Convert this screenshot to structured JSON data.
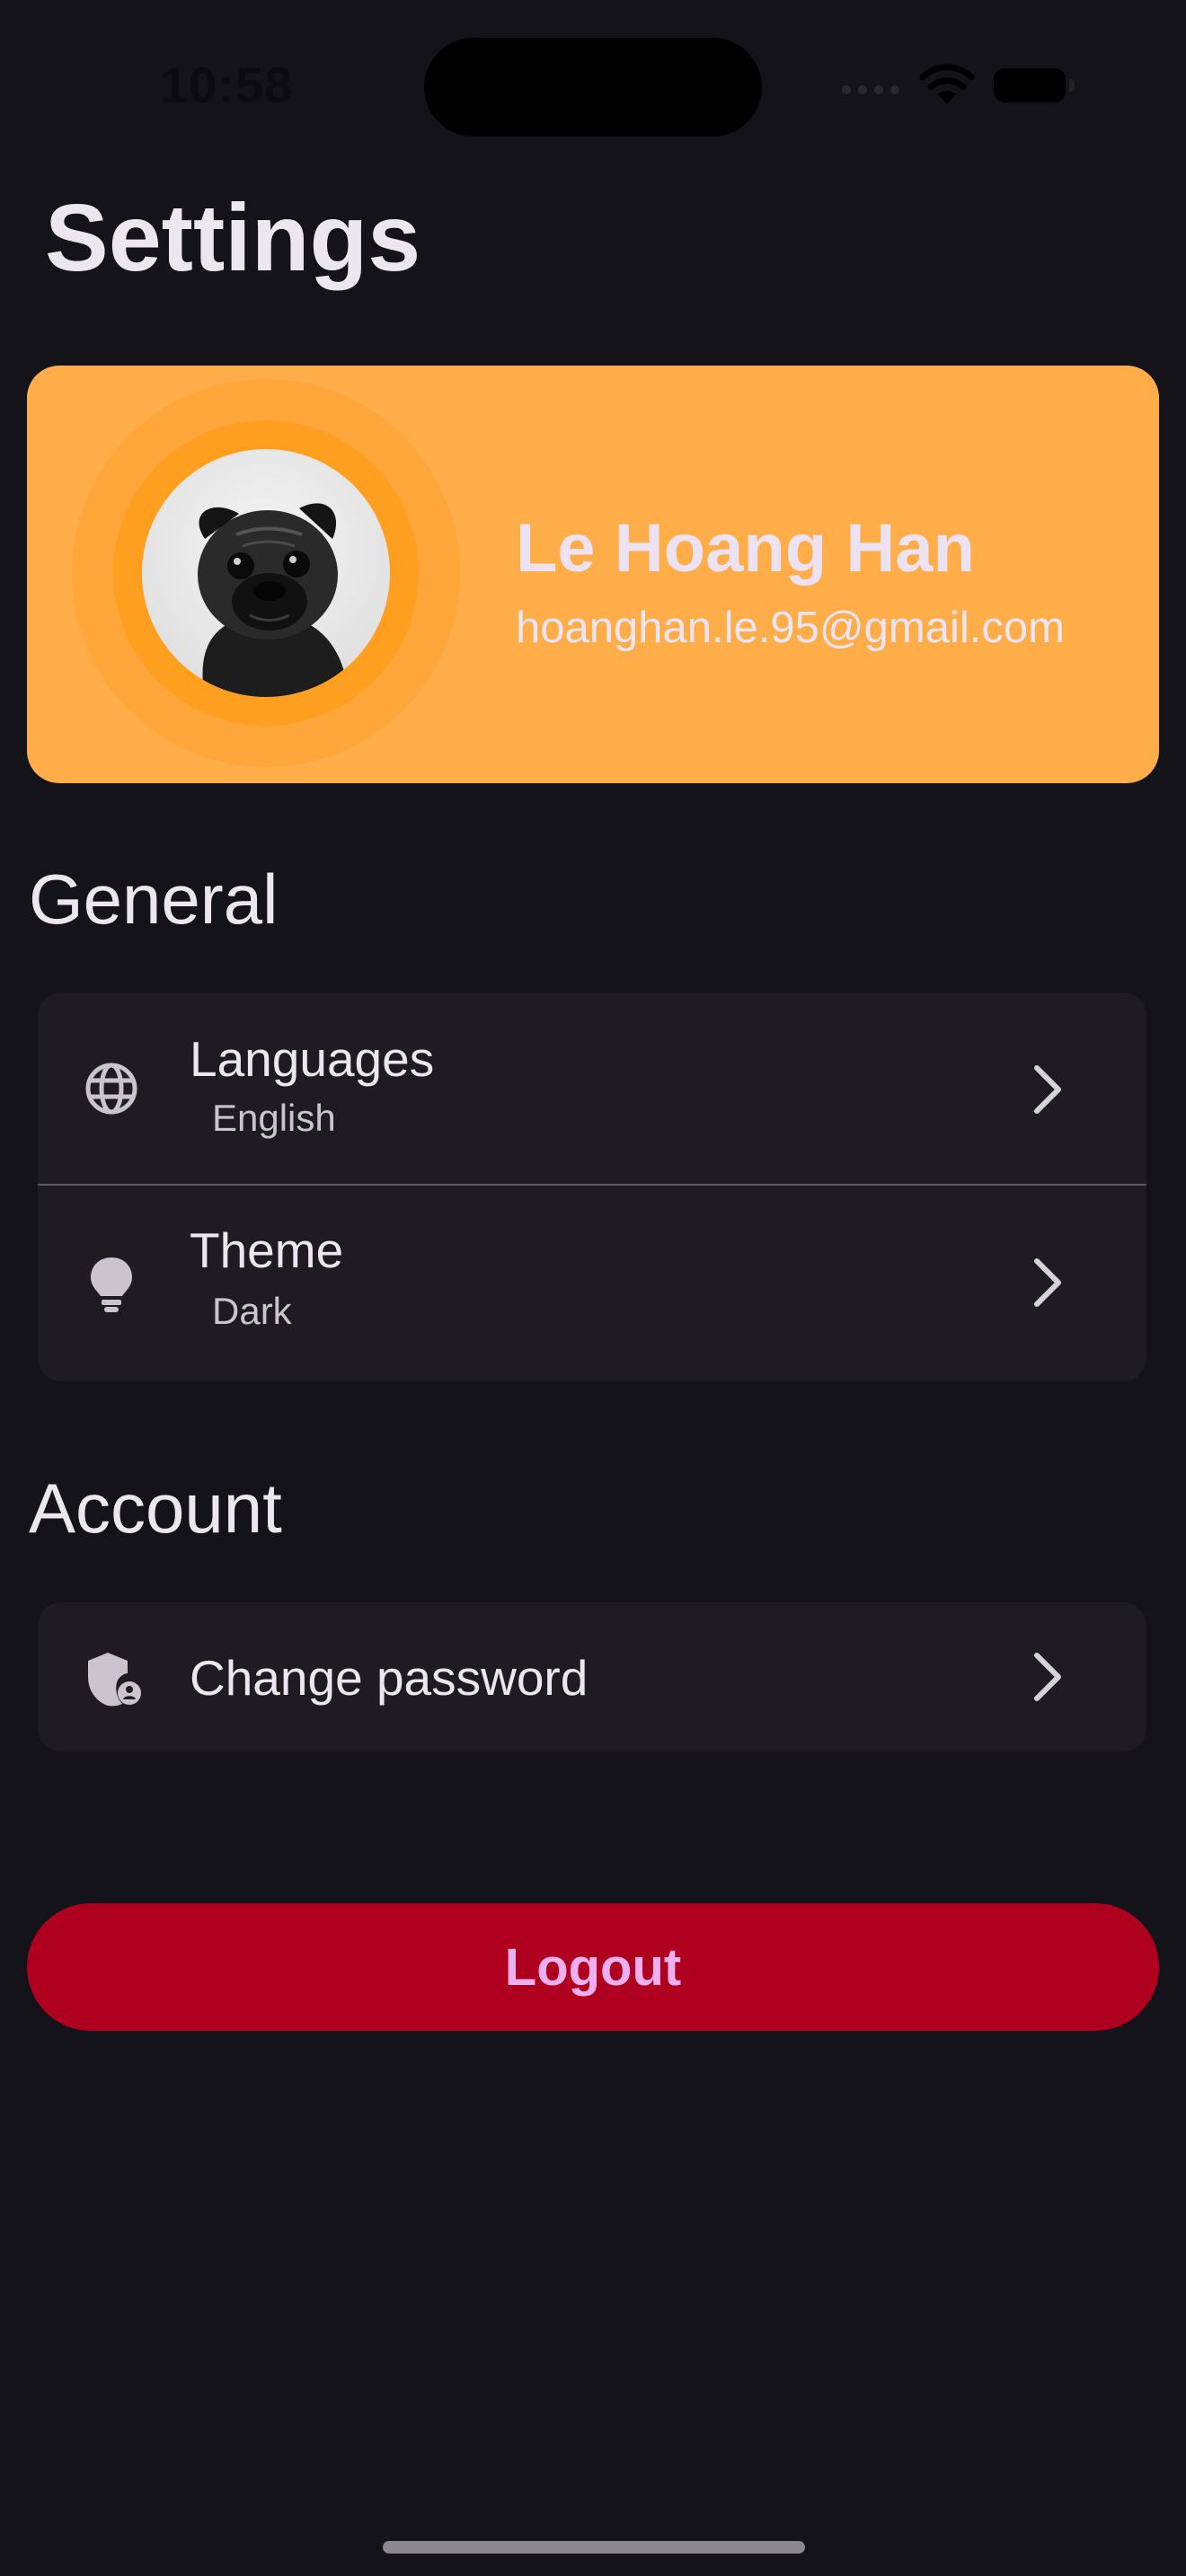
{
  "status_bar": {
    "time": "10:58"
  },
  "page": {
    "title": "Settings"
  },
  "profile": {
    "name": "Le Hoang Han",
    "email": "hoanghan.le.95@gmail.com",
    "avatar_icon": "pug-photo",
    "card_color": "#ffad48"
  },
  "sections": {
    "general": {
      "title": "General",
      "items": [
        {
          "icon": "globe-icon",
          "title": "Languages",
          "value": "English"
        },
        {
          "icon": "lightbulb-icon",
          "title": "Theme",
          "value": "Dark"
        }
      ]
    },
    "account": {
      "title": "Account",
      "items": [
        {
          "icon": "shield-person-icon",
          "title": "Change password"
        }
      ]
    }
  },
  "logout": {
    "label": "Logout",
    "color": "#b00020"
  }
}
